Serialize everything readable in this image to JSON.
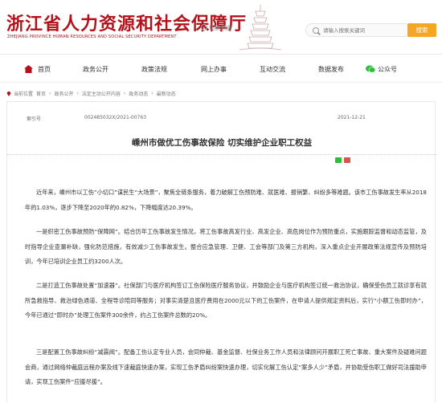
{
  "header": {
    "title_cn": "浙江省人力资源和社会保障厅",
    "title_en": "ZHEJIANG PROVINCE HUMAN RESOURCES AND SOCIAL SECURITY DEPARTMENT",
    "switch_site": "切换频道",
    "search_placeholder": "请输入搜索关键词",
    "search_button": "搜索"
  },
  "nav": {
    "items": [
      "首页",
      "政务公开",
      "政策法规",
      "网上办事",
      "互动交流",
      "数据发布",
      "公众号"
    ]
  },
  "breadcrumb": {
    "label": "当前位置",
    "items": [
      "首页",
      "政务公开",
      "法定主动公开内容",
      "政务动态",
      "最新动态"
    ]
  },
  "article": {
    "meta_index_label": "索引号",
    "meta_index_value": "002485032X/2021-00763",
    "meta_date": "2021-12-21",
    "title": "嵊州市做优工伤事故保险 切实维护企业职工权益",
    "paragraphs": [
      "近年来，嵊州市以工伤“小切口”谋民生“大场景”，聚焦全链条服务，着力破解工伤预防难、就医难、报销繁、纠纷多等难题。该市工伤事故发生率从2018年的1.03%，逐步下降至2020年的0.82%，下降幅度达20.39%。",
      "一是织密工伤事故预防“保障网”。结合历年工伤事故发生情况，将工伤事故高发行业、高发企业、高危岗位作为预防重点，实施跟踪监督和动态监管，及时指导企业查漏补缺，强化防范措施，有效减少工伤事故发生。整合应急管理、卫健、工会等部门及第三方机构，深入重点企业开展政策法规宣传及预防培训，今年已培训企业员工约3200人次。",
      "二是打造工伤事故处置“加速器”。社保部门与医疗机构签订工伤保险医疗服务协议，并鼓励企业与医疗机构签订统一救治协议，确保受伤员工就诊享有就所急救指导、救治绿色通道、全程导诊陪同等服务；对事实清楚且医疗费用在2000元以下的工伤案件，在申请人提供规定资料后，实行“小额工伤即时办”，今年已通过“即时办”处理工伤案件300余件，约占工伤案件总数的20%。",
      "三是配置工伤事故纠纷“减震阀”。配备工伤认定专业人员，会同仲裁、基金监督、社保业务工作人员和法律顾问开展职工死亡事故、重大案件及疑难问题会商，通过网络仲裁庭远程办案及线下速裁庭快速办案，实现工伤矛盾纠纷案快速办理，切实化解工伤认定“案多人少”矛盾，并协助受伤职工做好司法援助申请，实现工伤案件“应援尽援”。"
    ]
  },
  "colors": {
    "brand_red": "#b3121b",
    "search_orange": "#f5a623",
    "wechat_green": "#2dbf3b"
  }
}
